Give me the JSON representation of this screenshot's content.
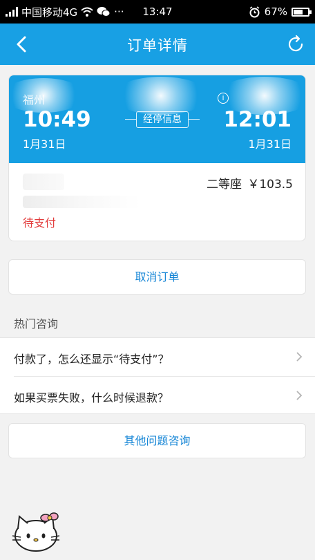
{
  "status_bar": {
    "carrier": "中国移动4G",
    "more": "···",
    "time": "13:47",
    "battery": "67%",
    "battery_level": 0.67
  },
  "header": {
    "title": "订单详情"
  },
  "order": {
    "departure": {
      "station": "福州",
      "time": "10:49",
      "date": "1月31日"
    },
    "arrival": {
      "time": "12:01",
      "date": "1月31日"
    },
    "stop_info_label": "经停信息",
    "info_icon": "i",
    "seat_class": "二等座",
    "price": "￥103.5",
    "status": "待支付"
  },
  "actions": {
    "cancel_label": "取消订单",
    "other_label": "其他问题咨询"
  },
  "faq": {
    "title": "热门咨询",
    "items": [
      {
        "text": "付款了，怎么还显示“待支付”？"
      },
      {
        "text": "如果买票失败，什么时候退款？"
      }
    ]
  },
  "colors": {
    "brand": "#18a0e4",
    "link": "#1686d6",
    "status_pending": "#e23b3b"
  }
}
